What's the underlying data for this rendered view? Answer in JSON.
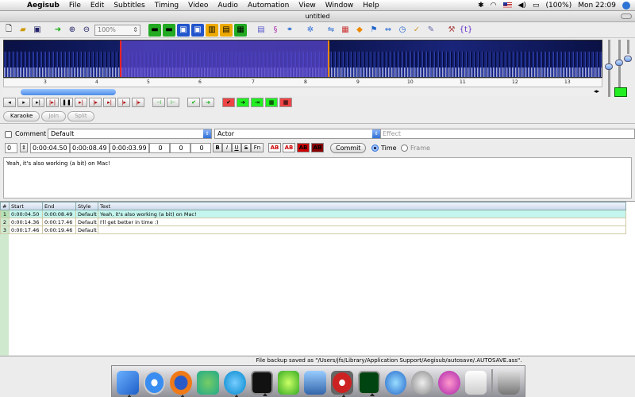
{
  "menubar": {
    "app": "Aegisub",
    "items": [
      "File",
      "Edit",
      "Subtitles",
      "Timing",
      "Video",
      "Audio",
      "Automation",
      "View",
      "Window",
      "Help"
    ],
    "battery": "(100%)",
    "clock": "Mon 22:09"
  },
  "window": {
    "title": "untitled"
  },
  "toolbar": {
    "zoom_value": "100%",
    "icons": [
      "new-file-icon",
      "open-file-icon",
      "save-file-icon",
      "jump-icon",
      "zoom-in-icon",
      "zoom-out-icon"
    ]
  },
  "audio": {
    "ticks": [
      "3",
      "4",
      "5",
      "6",
      "7",
      "8",
      "9",
      "10",
      "11",
      "12",
      "13"
    ],
    "left_marker_color": "#ff2222",
    "right_marker_color": "#ff8800"
  },
  "karaoke": {
    "karaoke_label": "Karaoke",
    "join_label": "Join",
    "split_label": "Split"
  },
  "edit": {
    "comment_label": "Comment",
    "style_value": "Default",
    "actor_value": "Actor",
    "effect_placeholder": "Effect",
    "layer_value": "0",
    "start_time": "0:00:04.50",
    "end_time": "0:00:08.49",
    "duration": "0:00:03.99",
    "margin_l": "0",
    "margin_r": "0",
    "margin_v": "0",
    "bold_label": "B",
    "italic_label": "I",
    "underline_label": "U",
    "strike_label": "S",
    "font_label": "Fn",
    "color_labels": [
      "AB",
      "AB",
      "AB",
      "AB"
    ],
    "commit_label": "Commit",
    "time_label": "Time",
    "frame_label": "Frame",
    "text": "Yeah, it's also working (a bit) on Mac!"
  },
  "grid": {
    "headers": [
      "#",
      "Start",
      "End",
      "Style",
      "Text"
    ],
    "rows": [
      {
        "num": "1",
        "start": "0:00:04.50",
        "end": "0:00:08.49",
        "style": "Default",
        "text": "Yeah, it's also working (a bit) on Mac!"
      },
      {
        "num": "2",
        "start": "0:00:14.36",
        "end": "0:00:17.46",
        "style": "Default",
        "text": "I'll get better in time :)"
      },
      {
        "num": "3",
        "start": "0:00:17.46",
        "end": "0:00:19.46",
        "style": "Default",
        "text": ""
      }
    ]
  },
  "status": {
    "message": "File backup saved as \"/Users/jfs/Library/Application Support/Aegisub/autosave/.AUTOSAVE.ass\"."
  }
}
